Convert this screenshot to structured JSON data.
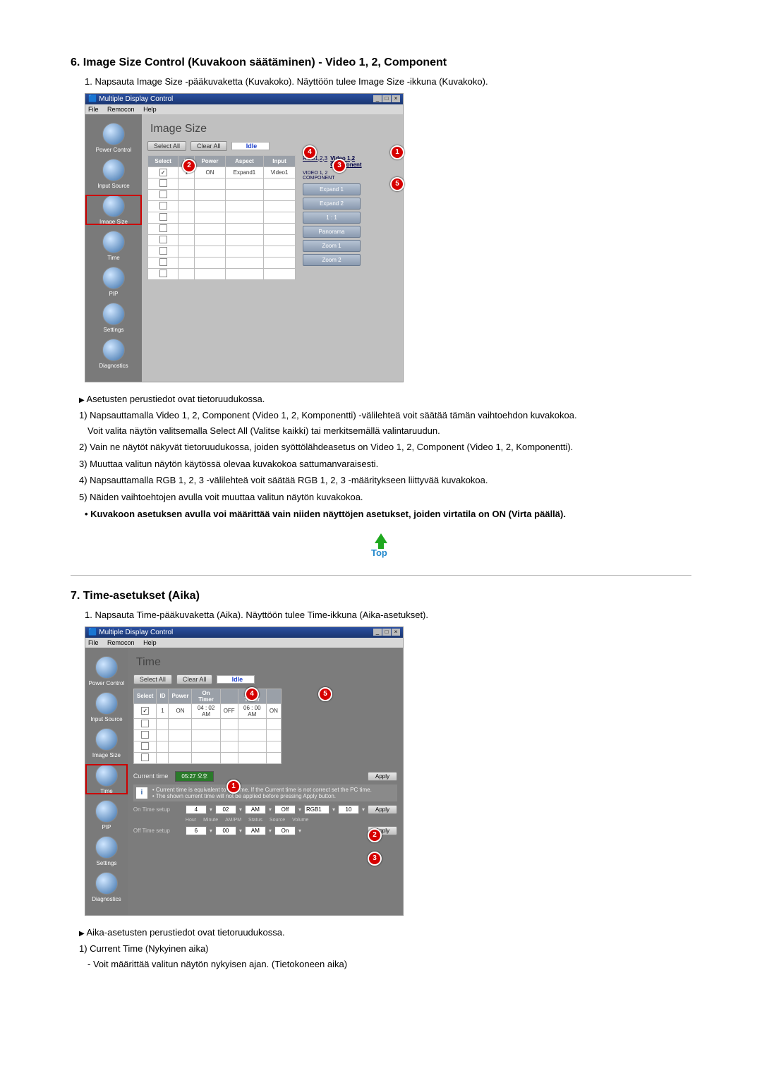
{
  "doc": {
    "section6_title": "6. Image Size Control (Kuvakoon säätäminen) - Video 1, 2, Component",
    "s6_p1": "1.  Napsauta Image Size -pääkuvaketta (Kuvakoko). Näyttöön tulee Image Size -ikkuna (Kuvakoko).",
    "s6_arrow": "Asetusten perustiedot ovat tietoruudukossa.",
    "s6_1": "1) Napsauttamalla Video 1, 2, Component (Video 1, 2, Komponentti) -välilehteä voit säätää tämän vaihtoehdon kuvakokoa.",
    "s6_1b": "Voit valita näytön valitsemalla Select All (Valitse kaikki) tai merkitsemällä valintaruudun.",
    "s6_2": "2) Vain ne näytöt näkyvät tietoruudukossa, joiden syöttölähdeasetus on Video 1, 2, Component (Video 1, 2, Komponentti).",
    "s6_3": "3) Muuttaa valitun näytön käytössä olevaa kuvakokoa sattumanvaraisesti.",
    "s6_4": "4) Napsauttamalla RGB 1, 2, 3 -välilehteä voit säätää RGB 1, 2, 3 -määritykseen liittyvää kuvakokoa.",
    "s6_5": "5) Näiden vaihtoehtojen avulla voit muuttaa valitun näytön kuvakokoa.",
    "s6_note": "Kuvakoon asetuksen avulla voi määrittää vain niiden näyttöjen asetukset, joiden virtatila on ON (Virta päällä).",
    "section7_title": "7. Time-asetukset (Aika)",
    "s7_p1": "1.  Napsauta Time-pääkuvaketta (Aika). Näyttöön tulee Time-ikkuna (Aika-asetukset).",
    "s7_arrow": "Aika-asetusten perustiedot ovat tietoruudukossa.",
    "s7_1": "1) Current Time (Nykyinen aika)",
    "s7_1a": "- Voit määrittää valitun näytön nykyisen ajan. (Tietokoneen aika)"
  },
  "app_common": {
    "win_title": "Multiple Display Control",
    "menu_file": "File",
    "menu_remocon": "Remocon",
    "menu_help": "Help",
    "sidebar_power": "Power Control",
    "sidebar_input": "Input Source",
    "sidebar_image": "Image Size",
    "sidebar_time": "Time",
    "sidebar_pip": "PIP",
    "sidebar_settings": "Settings",
    "sidebar_diag": "Diagnostics",
    "select_all": "Select All",
    "clear_all": "Clear All",
    "idle": "Idle"
  },
  "img_size": {
    "panel_title": "Image Size",
    "headers": {
      "select": "Select",
      "id": "ID",
      "power": "Power",
      "aspect": "Aspect",
      "input": "Input"
    },
    "rows": [
      {
        "select": true,
        "id": "1",
        "power": "ON",
        "aspect": "Expand1",
        "input": "Video1"
      },
      {
        "select": false
      },
      {
        "select": false
      },
      {
        "select": false
      },
      {
        "select": false
      },
      {
        "select": false
      },
      {
        "select": false
      },
      {
        "select": false
      },
      {
        "select": false
      },
      {
        "select": false
      }
    ],
    "tab_rgb": "RGB1,2,3",
    "tab_video": "Video 1,2\nComponent",
    "sublabel": "VIDEO 1, 2\nCOMPONENT",
    "options": [
      "Expand 1",
      "Expand 2",
      "1 : 1",
      "Panorama",
      "Zoom 1",
      "Zoom 2"
    ]
  },
  "time": {
    "panel_title": "Time",
    "headers": {
      "select": "Select",
      "id": "ID",
      "power": "Power",
      "on_timer": "On Timer",
      "on_status": "",
      "off_timer": "Off Timer",
      "off_status": ""
    },
    "rows": [
      {
        "select": true,
        "id": "1",
        "power": "ON",
        "on_timer": "04 : 02  AM",
        "on_status": "OFF",
        "off_timer": "06 : 00  AM",
        "off_status": "ON"
      },
      {
        "select": false
      },
      {
        "select": false
      },
      {
        "select": false
      },
      {
        "select": false
      }
    ],
    "current_time_label": "Current time",
    "current_time_value": "05:27 오후",
    "apply": "Apply",
    "info_line1": "• Current time is equivalent to PC time. If the Current time is not correct set the PC time.",
    "info_line2": "• The shown current time will not be applied before pressing Apply button.",
    "on_setup_label": "On Time setup",
    "off_setup_label": "Off Time setup",
    "on_setup": {
      "hour": "4",
      "minute": "02",
      "ampm": "AM",
      "status": "Off",
      "source": "RGB1",
      "volume": "10"
    },
    "off_setup": {
      "hour": "6",
      "minute": "00",
      "ampm": "AM",
      "status": "On"
    },
    "field_labels": {
      "hour": "Hour",
      "minute": "Minute",
      "ampm": "AM/PM",
      "status": "Status",
      "source": "Source",
      "volume": "Volume"
    }
  },
  "top_icon_label": "Top"
}
